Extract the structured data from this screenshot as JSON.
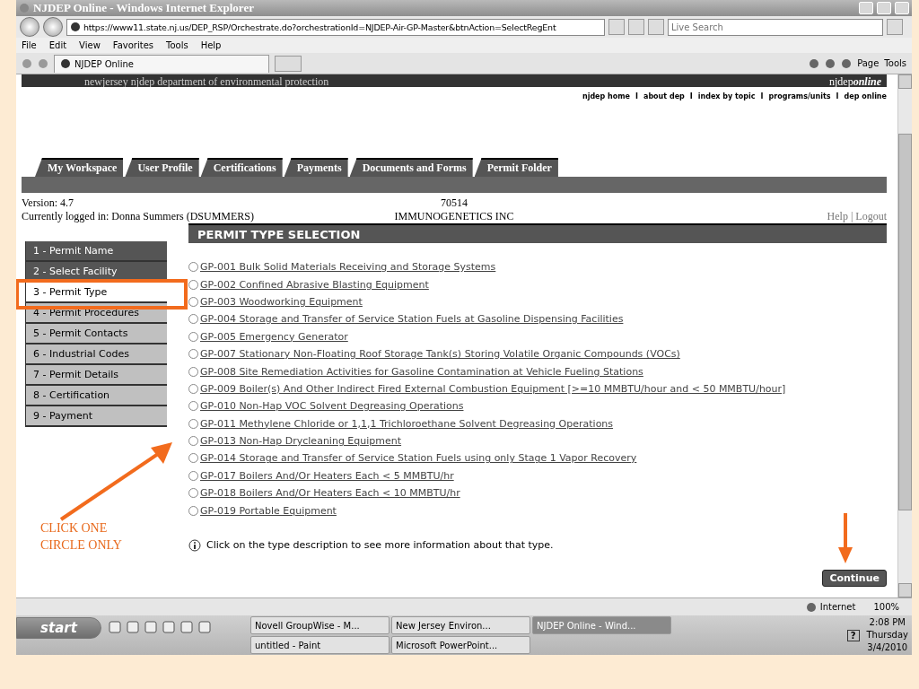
{
  "window": {
    "title": "NJDEP Online - Windows Internet Explorer"
  },
  "address_bar": {
    "url": "https://www11.state.nj.us/DEP_RSP/Orchestrate.do?orchestrationId=NJDEP-Air-GP-Master&btnAction=SelectRegEnt",
    "search_placeholder": "Live Search"
  },
  "menu": [
    "File",
    "Edit",
    "View",
    "Favorites",
    "Tools",
    "Help"
  ],
  "browser_tab": {
    "title": "NJDEP Online"
  },
  "command_bar": [
    "Page",
    "Tools"
  ],
  "site_header": {
    "logo_small": "newjersey",
    "logo": "njdep",
    "subtitle": "department of environmental protection",
    "brand": "njdep",
    "brand_suffix": "online"
  },
  "top_links": [
    {
      "label": "njdep home"
    },
    {
      "separator": "I",
      "label": "about dep"
    },
    {
      "separator": "I",
      "label": "index by topic"
    },
    {
      "separator": "I",
      "label": "programs/units"
    },
    {
      "separator": "I",
      "label": "dep online"
    }
  ],
  "tabs": [
    "My Workspace",
    "User Profile",
    "Certifications",
    "Payments",
    "Documents and Forms",
    "Permit Folder"
  ],
  "info": {
    "version": "Version: 4.7",
    "logged_in": "Currently logged in: Donna Summers (DSUMMERS)",
    "number": "70514",
    "company": "IMMUNOGENETICS INC",
    "help": "Help",
    "separator": "|",
    "logout": "Logout"
  },
  "steps": [
    {
      "label": "1 - Permit Name",
      "done": true,
      "selected": false
    },
    {
      "label": "2 - Select Facility",
      "done": true,
      "selected": false
    },
    {
      "label": "3 - Permit Type",
      "done": false,
      "selected": true
    },
    {
      "label": "4 - Permit Procedures",
      "done": false,
      "selected": false
    },
    {
      "label": "5 - Permit Contacts",
      "done": false,
      "selected": false
    },
    {
      "label": "6 - Industrial Codes",
      "done": false,
      "selected": false
    },
    {
      "label": "7 - Permit Details",
      "done": false,
      "selected": false
    },
    {
      "label": "8 - Certification",
      "done": false,
      "selected": false
    },
    {
      "label": "9 - Payment",
      "done": false,
      "selected": false
    }
  ],
  "panel": {
    "title": "PERMIT TYPE SELECTION",
    "options": [
      {
        "label": "GP-001 Bulk Solid Materials Receiving and Storage Systems",
        "selected": false
      },
      {
        "label": "GP-002 Confined Abrasive Blasting Equipment",
        "selected": false
      },
      {
        "label": "GP-003 Woodworking Equipment",
        "selected": false
      },
      {
        "label": "GP-004 Storage and Transfer of Service Station Fuels at Gasoline Dispensing Facilities",
        "selected": false
      },
      {
        "label": "GP-005 Emergency Generator",
        "selected": false
      },
      {
        "label": "GP-007 Stationary Non-Floating Roof Storage Tank(s) Storing Volatile Organic Compounds (VOCs)",
        "selected": false
      },
      {
        "label": "GP-008 Site Remediation Activities for Gasoline Contamination at Vehicle Fueling Stations",
        "selected": false
      },
      {
        "label": "GP-009 Boiler(s) And Other Indirect Fired External Combustion Equipment [>=10 MMBTU/hour and < 50 MMBTU/hour]",
        "selected": false
      },
      {
        "label": "GP-010 Non-Hap VOC Solvent Degreasing Operations",
        "selected": false
      },
      {
        "label": "GP-011 Methylene Chloride or 1,1,1 Trichloroethane Solvent Degreasing Operations",
        "selected": false
      },
      {
        "label": "GP-013 Non-Hap Drycleaning Equipment",
        "selected": false
      },
      {
        "label": "GP-014 Storage and Transfer of Service Station Fuels using only Stage 1 Vapor Recovery",
        "selected": false
      },
      {
        "label": "GP-017 Boilers And/Or Heaters Each < 5 MMBTU/hr",
        "selected": false
      },
      {
        "label": "GP-018 Boilers And/Or Heaters Each < 10 MMBTU/hr",
        "selected": false
      },
      {
        "label": "GP-019 Portable Equipment",
        "selected": false
      }
    ],
    "info": "Click on the type description to see more information about that type.",
    "continue": "Continue"
  },
  "annotation": {
    "text": "CLICK ONE CIRCLE ONLY"
  },
  "status_bar": {
    "zone": "Internet",
    "zoom": "100%"
  },
  "taskbar": {
    "start": "start",
    "tasks": [
      {
        "label": "Novell GroupWise - M...",
        "selected": false
      },
      {
        "label": "New Jersey Environ...",
        "selected": false
      },
      {
        "label": "NJDEP Online - Wind...",
        "selected": true
      },
      {
        "label": "untitled - Paint",
        "selected": false
      },
      {
        "label": "Microsoft PowerPoint...",
        "selected": false
      }
    ],
    "help": "?",
    "time": "2:08 PM",
    "day": "Thursday",
    "date": "3/4/2010"
  }
}
